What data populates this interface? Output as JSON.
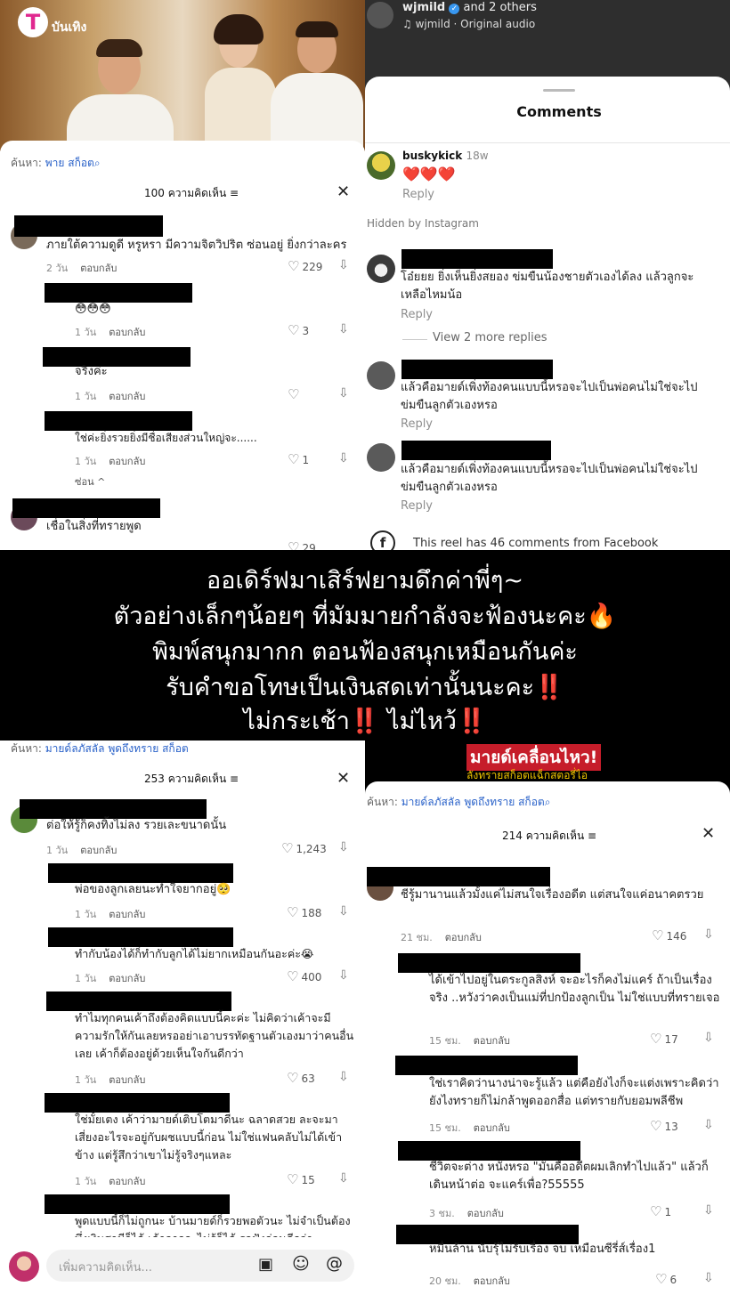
{
  "top_left": {
    "logo_letter": "T",
    "logo_text": "บันเทิง",
    "search_prefix": "ค้นหา:",
    "search_term": "พาย สก็อต",
    "count_header": "100 ความคิดเห็น",
    "comments": [
      {
        "text": "ภายใต้ความดูดี หรูหรา มีความจิตวิปริต ซ่อนอยู่ ยิ่งกว่าละคร",
        "time": "2 วัน",
        "reply": "ตอบกลับ",
        "likes": "229"
      },
      {
        "text": "😳😳😳",
        "time": "1 วัน",
        "reply": "ตอบกลับ",
        "likes": "3"
      },
      {
        "text": "จริงค่ะ",
        "time": "1 วัน",
        "reply": "ตอบกลับ",
        "likes": ""
      },
      {
        "text": "ใช่ค่ะยิ่งรวยยิ่งมีชื่อเสียงส่วนใหญ่จะ......",
        "time": "1 วัน",
        "reply": "ตอบกลับ",
        "likes": "1"
      },
      {
        "text": "เชื่อในสิ่งที่ทรายพูด",
        "time": "",
        "reply": "",
        "likes": "29"
      }
    ],
    "hide_label": "ซ่อน ^"
  },
  "top_right": {
    "user": "wjmild",
    "and_others": "and 2 others",
    "audio": "wjmild · Original audio",
    "title": "Comments",
    "first_user": "buskykick",
    "first_time": "18w",
    "first_text": "❤️❤️❤️",
    "reply_label": "Reply",
    "hidden_label": "Hidden by Instagram",
    "comments": [
      {
        "text": "โอ๋ยยย ยิ่งเห็นยิ่งสยอง ข่มขืนน้องชายตัวเองได้ลง แล้วลูกจะเหลือไหมน้อ"
      },
      {
        "text": "แล้วคือมายด์เพิ่งท้องคนแบบนี้หรอจะไปเป็นพ่อคนไม่ใช่จะไปข่มขืนลูกตัวเองหรอ"
      },
      {
        "text": "แล้วคือมายด์เพิ่งท้องคนแบบนี้หรอจะไปเป็นพ่อคนไม่ใช่จะไปข่มขืนลูกตัวเองหรอ"
      }
    ],
    "view_more": "View 2 more replies",
    "facebook_text": "This reel has 46 comments from Facebook"
  },
  "banner": {
    "lines": [
      "ออเดิร์ฟมาเสิร์ฟยามดึกค่าพี่ๆ~",
      "ตัวอย่างเล็กๆน้อยๆ ที่มัมมายกำลังจะฟ้องนะคะ🔥",
      "พิมพ์สนุกมากก ตอนฟ้องสนุกเหมือนกันค่ะ",
      "รับคำขอโทษเป็นเงินสดเท่านั้นนะคะ‼️",
      "ไม่กระเช้า‼️ ไม่ไหว้‼️"
    ]
  },
  "bottom_left": {
    "search_prefix": "ค้นหา:",
    "search_term": "มายด์ลภัสลัล พูดถึงทราย สก็อต",
    "count_header": "253 ความคิดเห็น",
    "comments": [
      {
        "text": "ต่อให้รู้ก็คงทิ้งไม่ลง รวยเละขนาดนั้น",
        "time": "1 วัน",
        "reply": "ตอบกลับ",
        "likes": "1,243"
      },
      {
        "text": "พ่อของลูกเลยนะทำใจยากอยู่🥺",
        "time": "1 วัน",
        "reply": "ตอบกลับ",
        "likes": "188"
      },
      {
        "text": "ทำกับน้องได้ก็ทำกับลูกได้ไม่ยากเหมือนกันอะค่ะ😭",
        "time": "1 วัน",
        "reply": "ตอบกลับ",
        "likes": "400"
      },
      {
        "text": "ทำไมทุกคนเค้าถึงต้องคิดแบบนี้คะค่ะ ไม่คิดว่าเค้าจะมีความรักให้กันเลยหรออย่าเอาบรรทัดฐานตัวเองมาว่าคนอื่นเลย เค้าก็ต้องอยู่ด้วยเห็นใจกันดีกว่า",
        "time": "1 วัน",
        "reply": "ตอบกลับ",
        "likes": "63"
      },
      {
        "text": "ใช่มั้ยเตง เค้าว่ามายด์เติบโตมาดีนะ ฉลาดสวย ละจะมาเสี่ยงอะไรจะอยู่กับผชแบบนี้ก่อน ไม่ใช่แฟนคลับไม่ได้เข้าข้าง แต่รู้สึกว่าเขาไม่รู้จริงๆแหละ",
        "time": "1 วัน",
        "reply": "ตอบกลับ",
        "likes": "15"
      },
      {
        "text": "พูดแบบนี้ก็ไม่ถูกนะ บ้านมายด์ก็รวยพอตัวนะ ไม่จำเป็นต้องพึ่งเงินสามีก็ได้ เค้าอาจจะไม่รู้ก็ได้ รอฟังก่อนดีกว่า",
        "time": "",
        "reply": "",
        "likes": ""
      }
    ],
    "input_placeholder": "เพิ่มความคิดเห็น..."
  },
  "bottom_right": {
    "bg_title": "มายด์เคลื่อนไหว!",
    "bg_sub": "ลังทรายสก็อตแฉ็กสตอรี่ไอ",
    "search_prefix": "ค้นหา:",
    "search_term": "มายด์ลภัสลัล พูดถึงทราย สก็อต",
    "count_header": "214 ความคิดเห็น",
    "comments": [
      {
        "text": "ชีรู้มานานแล้วมั้งแค่ไม่สนใจเรื่องอดีต แต่สนใจแค่อนาคตรวย",
        "time": "21 ชม.",
        "reply": "ตอบกลับ",
        "likes": "146"
      },
      {
        "text": "ได้เข้าไปอยู่ในตระกูลสิงห์ จะอะไรก็คงไม่แคร์ ถ้าเป็นเรื่องจริง ..หวังว่าคงเป็นแม่ที่ปกป้องลูกเป็น ไม่ใช่แบบที่ทรายเจอ",
        "time": "15 ชม.",
        "reply": "ตอบกลับ",
        "likes": "17"
      },
      {
        "text": "ใช่เราคิดว่านางน่าจะรู้แล้ว แต่คือยังไงก็จะแต่งเพราะคิดว่ายังไงทรายก็ไม่กล้าพูดออกสื่อ แต่ทรายกับยอมพลีชีพ",
        "time": "15 ชม.",
        "reply": "ตอบกลับ",
        "likes": "13"
      },
      {
        "text": "ชีวิตจะต่าง หนังหรอ \"มันคืออดีตผมเลิกทำไปแล้ว\" แล้วก็เดินหน้าต่อ จะแคร์เพื่อ?55555",
        "time": "3 ชม.",
        "reply": "ตอบกลับ",
        "likes": "1"
      },
      {
        "text": "หมื่นล้าน นับรุ้ไม่รับเรื่อง จบ เหมือนซีรี่ส์เรื่อง1",
        "time": "20 ชม.",
        "reply": "ตอบกลับ",
        "likes": "6"
      }
    ]
  },
  "colors": {
    "link_blue": "#2a62c9",
    "heart_red": "#e02020",
    "banner_bg": "#000000"
  }
}
